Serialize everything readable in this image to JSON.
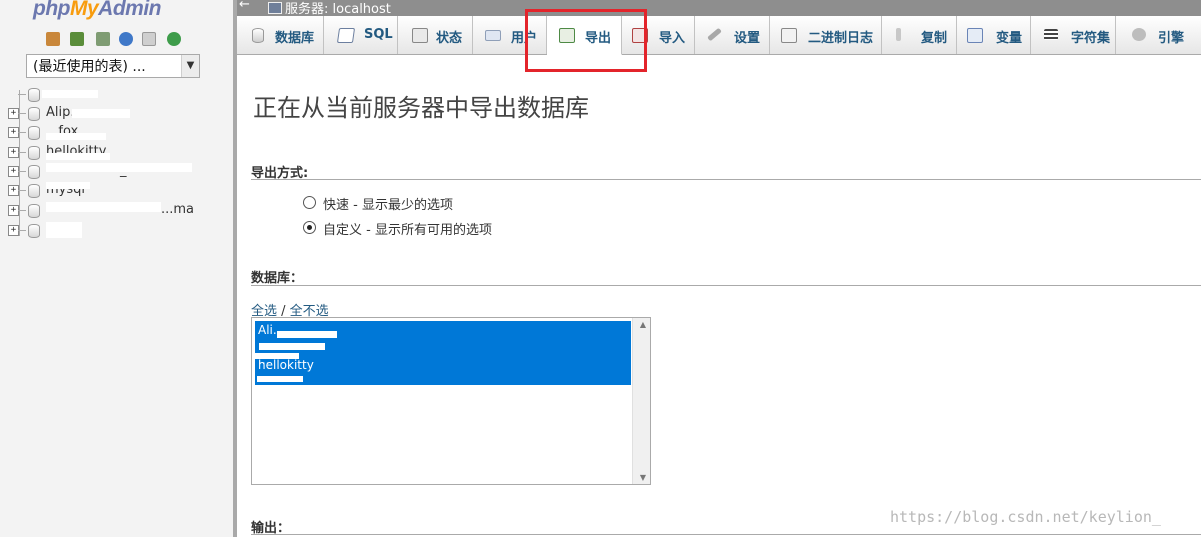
{
  "left_panel": {
    "logo": {
      "php": "php",
      "my": "My",
      "admin": "Admin"
    },
    "icons": [
      "home-icon",
      "logout-icon",
      "sql-query-icon",
      "help-icon",
      "docs-icon",
      "reload-icon"
    ],
    "recent_select": {
      "value": "(最近使用的表) ..."
    },
    "db_tree": [
      {
        "name": "Alip..."
      },
      {
        "name": "...fox"
      },
      {
        "name": "hellokitty"
      },
      {
        "name": "_"
      },
      {
        "name": "mysql"
      },
      {
        "name": "...ma"
      },
      {
        "name": "..."
      }
    ]
  },
  "top_bar": {
    "back": "←",
    "server": "服务器: localhost"
  },
  "tabs": [
    {
      "label": "数据库",
      "icon": "database-icon"
    },
    {
      "label": "SQL",
      "icon": "sql-icon"
    },
    {
      "label": "状态",
      "icon": "status-icon"
    },
    {
      "label": "用户",
      "icon": "users-icon"
    },
    {
      "label": "导出",
      "icon": "export-icon",
      "active": true
    },
    {
      "label": "导入",
      "icon": "import-icon"
    },
    {
      "label": "设置",
      "icon": "settings-icon"
    },
    {
      "label": "二进制日志",
      "icon": "binlog-icon"
    },
    {
      "label": "复制",
      "icon": "replication-icon"
    },
    {
      "label": "变量",
      "icon": "variables-icon"
    },
    {
      "label": "字符集",
      "icon": "charset-icon"
    },
    {
      "label": "引擎",
      "icon": "engine-icon"
    }
  ],
  "main": {
    "title": "正在从当前服务器中导出数据库",
    "export_method": {
      "heading": "导出方式:",
      "options": [
        {
          "label": "快速 - 显示最少的选项",
          "checked": false
        },
        {
          "label": "自定义 - 显示所有可用的选项",
          "checked": true
        }
      ]
    },
    "databases": {
      "heading": "数据库：",
      "select_all": "全选",
      "separator": " / ",
      "select_none": "全不选",
      "selected_items": [
        "Ali...",
        "...",
        "...",
        "hellokitty"
      ]
    },
    "output": {
      "heading": "输出："
    }
  },
  "watermark": "https://blog.csdn.net/keylion_",
  "colors": {
    "highlight": "#e3242b",
    "selection": "#0078d7",
    "link": "#235a81"
  }
}
